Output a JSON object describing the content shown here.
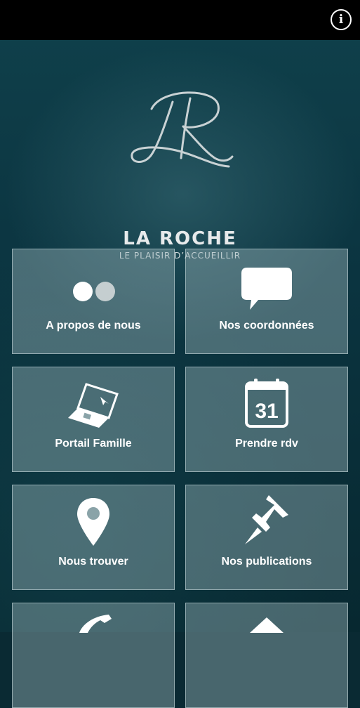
{
  "header": {
    "info_glyph": "i"
  },
  "brand": {
    "name": "LA ROCHE",
    "tagline": "LE PLAISIR D’ACCUEILLIR"
  },
  "tiles": [
    {
      "label": "A propos de nous",
      "icon": "dots-icon"
    },
    {
      "label": "Nos coordonnées",
      "icon": "speech-bubble-icon"
    },
    {
      "label": "Portail Famille",
      "icon": "laptop-icon"
    },
    {
      "label": "Prendre rdv",
      "icon": "calendar-icon",
      "calendar_day": "31"
    },
    {
      "label": "Nous trouver",
      "icon": "map-pin-icon"
    },
    {
      "label": "Nos publications",
      "icon": "pushpin-icon"
    },
    {
      "label": "",
      "icon": "phone-icon"
    },
    {
      "label": "",
      "icon": "home-icon"
    }
  ],
  "colors": {
    "tile_bg": "#8aa3a8",
    "background": "#0b3440",
    "topbar": "#000000"
  }
}
